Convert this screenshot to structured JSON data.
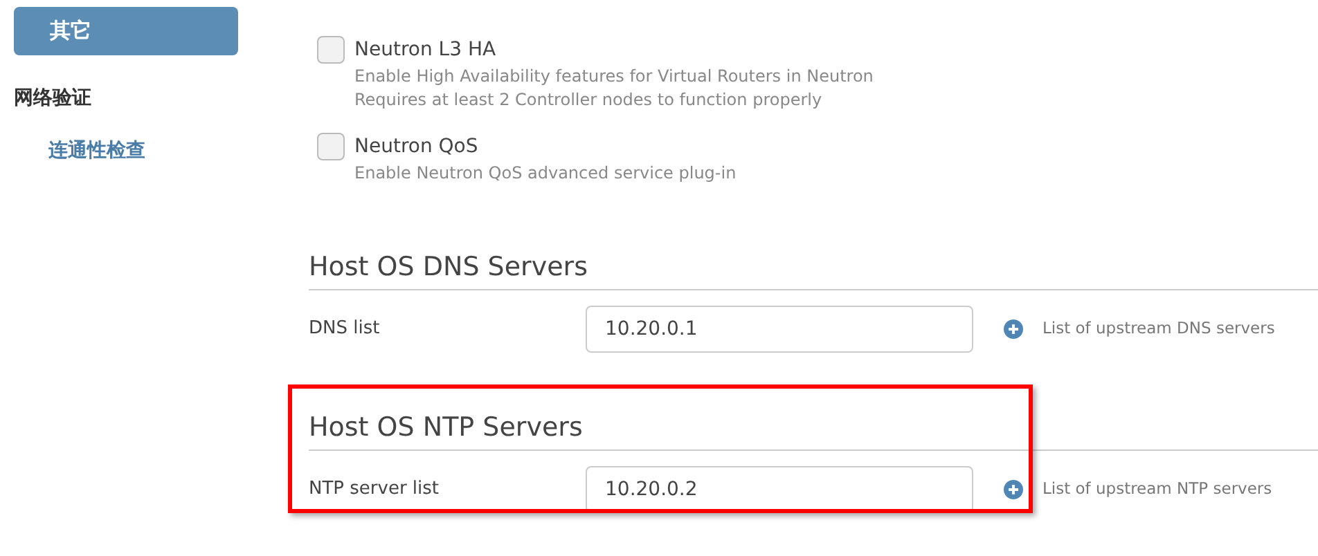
{
  "sidebar": {
    "items": [
      {
        "kind": "button",
        "label": "其它",
        "selected": true
      },
      {
        "kind": "group",
        "label": "网络验证",
        "children": [
          {
            "label": "连通性检查",
            "selected": false
          }
        ]
      }
    ]
  },
  "options": [
    {
      "label": "Neutron L3 HA",
      "checked": false,
      "description": [
        "Enable High Availability features for Virtual Routers in Neutron",
        "Requires at least 2 Controller nodes to function properly"
      ]
    },
    {
      "label": "Neutron QoS",
      "checked": false,
      "description": [
        "Enable Neutron QoS advanced service plug-in"
      ]
    }
  ],
  "sections": [
    {
      "title": "Host OS DNS Servers",
      "highlighted": false,
      "fields": [
        {
          "label": "DNS list",
          "value": "10.20.0.1",
          "help": "List of upstream DNS servers"
        }
      ]
    },
    {
      "title": "Host OS NTP Servers",
      "highlighted": true,
      "fields": [
        {
          "label": "NTP server list",
          "value": "10.20.0.2",
          "help": "List of upstream NTP servers"
        }
      ]
    }
  ]
}
